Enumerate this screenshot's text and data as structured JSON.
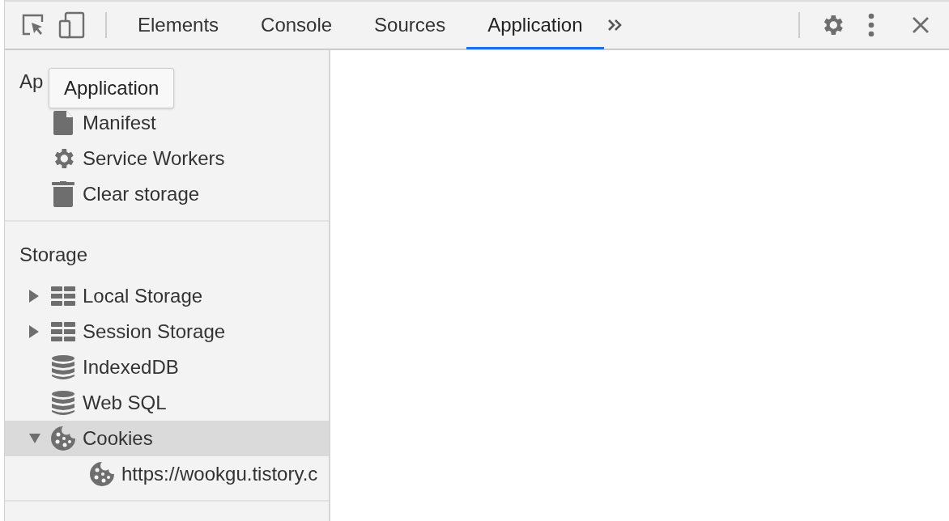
{
  "toolbar": {
    "tabs": [
      {
        "label": "Elements",
        "selected": false
      },
      {
        "label": "Console",
        "selected": false
      },
      {
        "label": "Sources",
        "selected": false
      },
      {
        "label": "Application",
        "selected": true
      }
    ]
  },
  "tooltip": "Application",
  "sidebar": {
    "sections": [
      {
        "title": "Ap",
        "items": [
          {
            "label": "Manifest",
            "kind": "file",
            "selected": false
          },
          {
            "label": "Service Workers",
            "kind": "gear",
            "selected": false
          },
          {
            "label": "Clear storage",
            "kind": "trash",
            "selected": false
          }
        ]
      },
      {
        "title": "Storage",
        "items": [
          {
            "label": "Local Storage",
            "kind": "table",
            "selected": false,
            "expanded": false
          },
          {
            "label": "Session Storage",
            "kind": "table",
            "selected": false,
            "expanded": false
          },
          {
            "label": "IndexedDB",
            "kind": "database",
            "selected": false
          },
          {
            "label": "Web SQL",
            "kind": "database",
            "selected": false
          },
          {
            "label": "Cookies",
            "kind": "cookie",
            "selected": true,
            "expanded": true,
            "children": [
              {
                "label": "https://wookgu.tistory.c",
                "kind": "cookie",
                "selected": false
              }
            ]
          }
        ]
      }
    ]
  }
}
